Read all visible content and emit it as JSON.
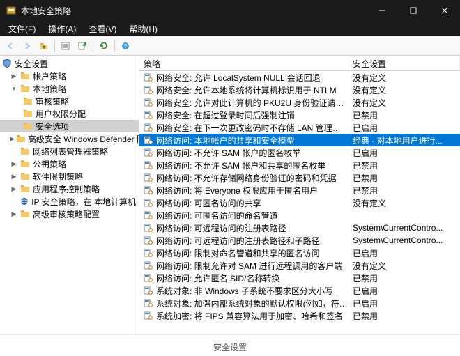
{
  "window": {
    "title": "本地安全策略"
  },
  "menubar": {
    "file": "文件(F)",
    "action": "操作(A)",
    "view": "查看(V)",
    "help": "帮助(H)"
  },
  "toolbar": {
    "back_icon": "back-arrow-icon",
    "forward_icon": "forward-arrow-icon",
    "up_icon": "up-folder-icon",
    "props_icon": "properties-icon",
    "export_icon": "export-list-icon",
    "refresh_icon": "refresh-icon",
    "help_icon": "help-icon"
  },
  "tree": {
    "root": "安全设置",
    "account": "帐户策略",
    "local": "本地策略",
    "audit": "审核策略",
    "userrights": "用户权限分配",
    "secoptions": "安全选项",
    "defender": "高级安全 Windows Defender 防火墙",
    "netlist": "网络列表管理器策略",
    "pubkey": "公钥策略",
    "software": "软件限制策略",
    "appctrl": "应用程序控制策略",
    "ipsec": "IP 安全策略，在 本地计算机",
    "advaudit": "高级审核策略配置"
  },
  "list": {
    "header_policy": "策略",
    "header_setting": "安全设置",
    "rows": [
      {
        "p": "网络安全: 允许 LocalSystem NULL 会话回退",
        "s": "没有定义"
      },
      {
        "p": "网络安全: 允许本地系统将计算机标识用于 NTLM",
        "s": "没有定义"
      },
      {
        "p": "网络安全: 允许对此计算机的 PKU2U 身份验证请求使用联...",
        "s": "没有定义"
      },
      {
        "p": "网络安全: 在超过登录时间后强制注销",
        "s": "已禁用"
      },
      {
        "p": "网络安全: 在下一次更改密码时不存储 LAN 管理器哈希值",
        "s": "已启用"
      },
      {
        "p": "网络访问: 本地帐户的共享和安全模型",
        "s": "经典 - 对本地用户进行...",
        "sel": true
      },
      {
        "p": "网络访问: 不允许 SAM 帐户的匿名枚举",
        "s": "已启用"
      },
      {
        "p": "网络访问: 不允许 SAM 帐户和共享的匿名枚举",
        "s": "已禁用"
      },
      {
        "p": "网络访问: 不允许存储网络身份验证的密码和凭据",
        "s": "已禁用"
      },
      {
        "p": "网络访问: 将 Everyone 权限应用于匿名用户",
        "s": "已禁用"
      },
      {
        "p": "网络访问: 可匿名访问的共享",
        "s": "没有定义"
      },
      {
        "p": "网络访问: 可匿名访问的命名管道",
        "s": ""
      },
      {
        "p": "网络访问: 可远程访问的注册表路径",
        "s": "System\\CurrentContro..."
      },
      {
        "p": "网络访问: 可远程访问的注册表路径和子路径",
        "s": "System\\CurrentContro..."
      },
      {
        "p": "网络访问: 限制对命名管道和共享的匿名访问",
        "s": "已启用"
      },
      {
        "p": "网络访问: 限制允许对 SAM 进行远程调用的客户端",
        "s": "没有定义"
      },
      {
        "p": "网络访问: 允许匿名 SID/名称转换",
        "s": "已禁用"
      },
      {
        "p": "系统对象: 非 Windows 子系统不要求区分大小写",
        "s": "已启用"
      },
      {
        "p": "系统对象: 加强内部系统对象的默认权限(例如，符号链接)",
        "s": "已启用"
      },
      {
        "p": "系统加密: 将 FIPS 兼容算法用于加密、哈希和签名",
        "s": "已禁用"
      }
    ]
  },
  "statusbar": {
    "text": "安全设置"
  }
}
